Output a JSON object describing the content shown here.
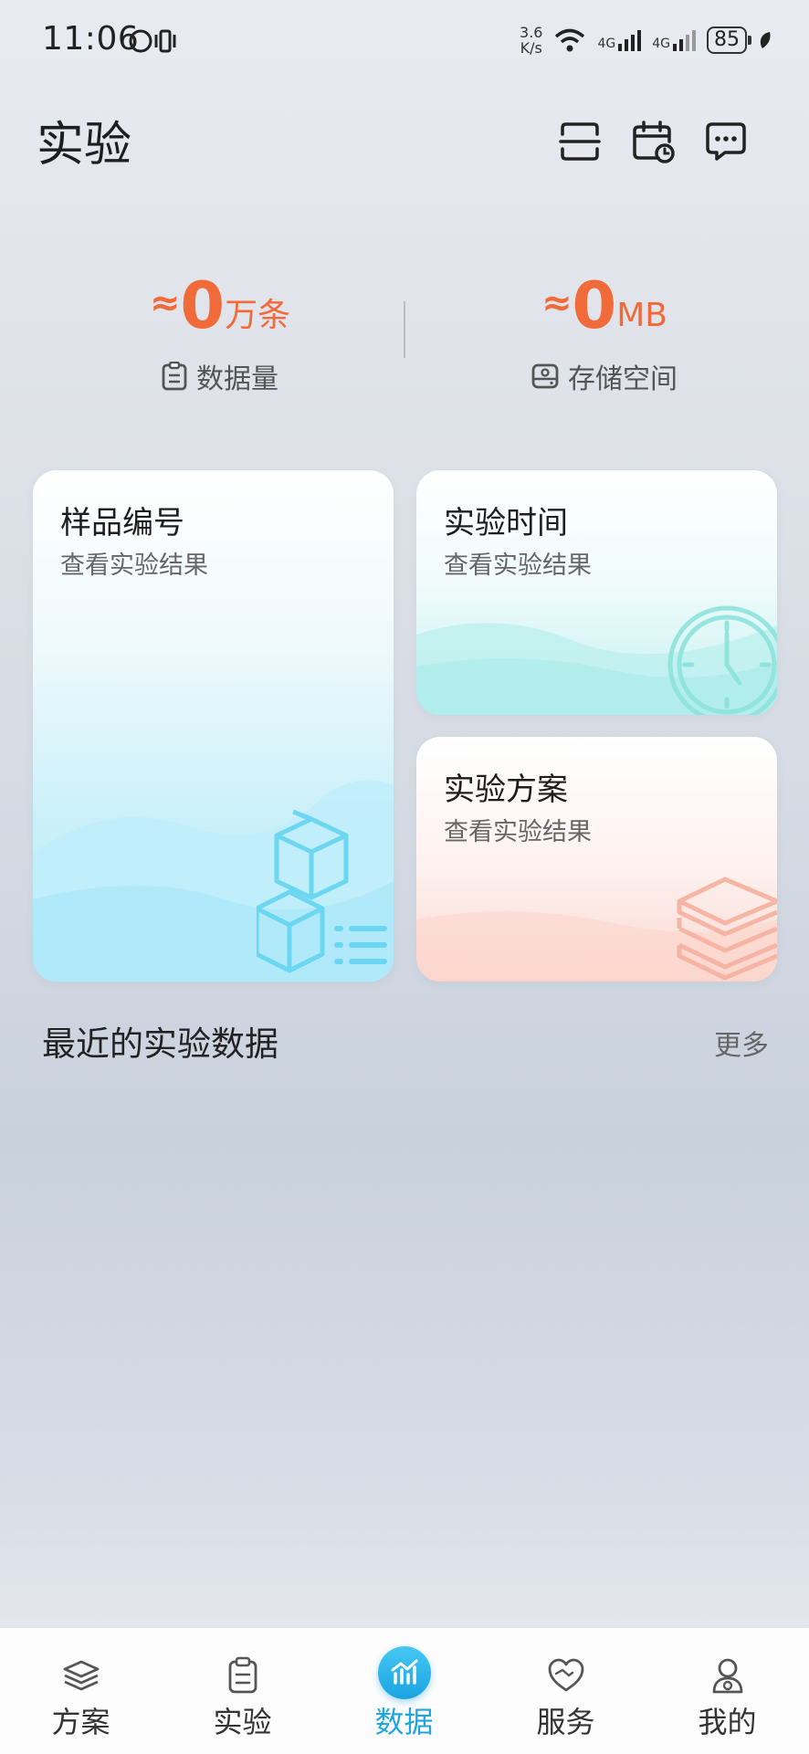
{
  "status_bar": {
    "time": "11:06",
    "net_speed_value": "3.6",
    "net_speed_unit": "K/s",
    "net1": "4G",
    "net2": "4G",
    "battery": "85"
  },
  "header": {
    "title": "实验"
  },
  "header_icons": [
    "scan-icon",
    "calendar-clock-icon",
    "message-icon"
  ],
  "stats": [
    {
      "approx": "≈",
      "value": "0",
      "unit": "万条",
      "label": "数据量",
      "icon": "clipboard-icon"
    },
    {
      "approx": "≈",
      "value": "0",
      "unit": "MB",
      "label": "存储空间",
      "icon": "storage-icon"
    }
  ],
  "cards": [
    {
      "title": "样品编号",
      "subtitle": "查看实验结果",
      "icon": "cubes-icon"
    },
    {
      "title": "实验时间",
      "subtitle": "查看实验结果",
      "icon": "clock-icon"
    },
    {
      "title": "实验方案",
      "subtitle": "查看实验结果",
      "icon": "layers-icon"
    }
  ],
  "recent": {
    "title": "最近的实验数据",
    "more": "更多"
  },
  "nav": [
    {
      "label": "方案",
      "icon": "layers-icon",
      "active": false
    },
    {
      "label": "实验",
      "icon": "clipboard-icon",
      "active": false
    },
    {
      "label": "数据",
      "icon": "bar-chart-icon",
      "active": true
    },
    {
      "label": "服务",
      "icon": "handshake-heart-icon",
      "active": false
    },
    {
      "label": "我的",
      "icon": "person-icon",
      "active": false
    }
  ],
  "colors": {
    "accent_orange": "#f16a3a",
    "accent_blue": "#1fa5e0",
    "card_sample": "#b4ebf8",
    "card_time": "#c5f2f1",
    "card_plan": "#fbd8d0"
  }
}
